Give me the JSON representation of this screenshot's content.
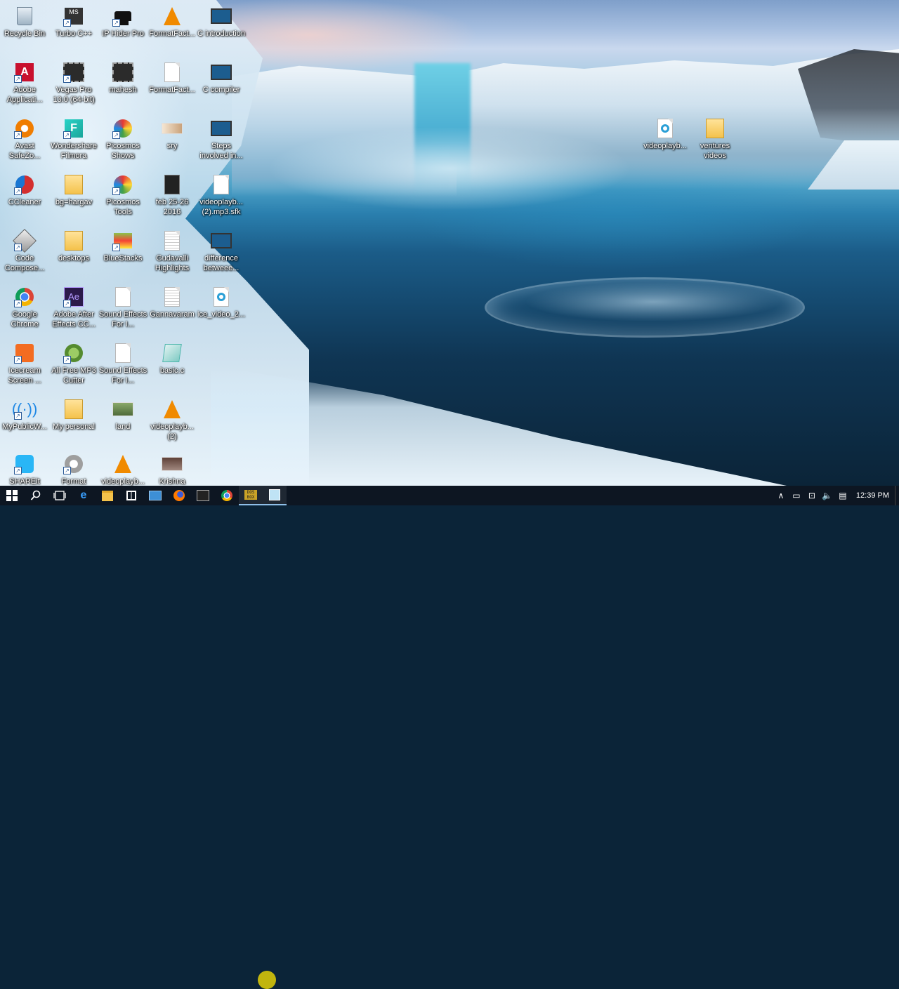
{
  "desktop_icons": [
    {
      "id": "recycle-bin",
      "label": "Recycle Bin",
      "icon": "recycle-bin-icon"
    },
    {
      "id": "turbo-cpp",
      "label": "Turbo C++",
      "icon": "turbo-cpp-icon"
    },
    {
      "id": "ip-hider-pro",
      "label": "IP Hider Pro",
      "icon": "ip-hider-icon"
    },
    {
      "id": "formatfactory-1",
      "label": "FormatFact...",
      "icon": "vlc-cone-icon"
    },
    {
      "id": "c-introduction",
      "label": "C introduction",
      "icon": "video-file-icon"
    },
    {
      "id": "adobe-applications",
      "label": "Adobe Applicati...",
      "icon": "adobe-icon"
    },
    {
      "id": "vegas-pro",
      "label": "Vegas Pro 13.0 (64-bit)",
      "icon": "film-icon"
    },
    {
      "id": "mahesh",
      "label": "mahesh",
      "icon": "film-icon"
    },
    {
      "id": "formatfactory-2",
      "label": "FormatFact...",
      "icon": "document-icon"
    },
    {
      "id": "c-compiler",
      "label": "C compiler",
      "icon": "video-file-icon"
    },
    {
      "id": "avast",
      "label": "Avast SafeZo...",
      "icon": "avast-icon"
    },
    {
      "id": "filmora",
      "label": "Wondershare Filmora",
      "icon": "filmora-icon"
    },
    {
      "id": "picosmos-shows",
      "label": "Picosmos Shows",
      "icon": "picosmos-icon"
    },
    {
      "id": "sry",
      "label": "sry",
      "icon": "image-file-icon"
    },
    {
      "id": "steps-involved",
      "label": "Steps involved in...",
      "icon": "video-file-icon"
    },
    {
      "id": "ccleaner",
      "label": "CCleaner",
      "icon": "ccleaner-icon"
    },
    {
      "id": "bg-hargav",
      "label": "bg=hargav",
      "icon": "zip-folder-icon"
    },
    {
      "id": "picosmos-tools",
      "label": "Picosmos Tools",
      "icon": "picosmos-icon"
    },
    {
      "id": "feb-25-26",
      "label": "feb 25-26 2016",
      "icon": "film-icon"
    },
    {
      "id": "videoplayback-sfk",
      "label": "videoplayb... (2).mp3.sfk",
      "icon": "document-icon"
    },
    {
      "id": "code-composer",
      "label": "Code Compose...",
      "icon": "cube-icon"
    },
    {
      "id": "desktops",
      "label": "desktops",
      "icon": "folder-icon"
    },
    {
      "id": "bluestacks",
      "label": "BlueStacks",
      "icon": "bluestacks-icon"
    },
    {
      "id": "gudavalli",
      "label": "Gudavalli Highlights",
      "icon": "text-file-icon"
    },
    {
      "id": "difference",
      "label": "difference betweee...",
      "icon": "video-file-icon"
    },
    {
      "id": "google-chrome",
      "label": "Google Chrome",
      "icon": "chrome-icon"
    },
    {
      "id": "after-effects",
      "label": "Adobe After Effects CC...",
      "icon": "after-effects-icon"
    },
    {
      "id": "sound-effects-1",
      "label": "Sound Effects For I...",
      "icon": "document-icon"
    },
    {
      "id": "gannavaram",
      "label": "Gannavaram",
      "icon": "text-file-icon"
    },
    {
      "id": "ice-video",
      "label": "ice_video_2...",
      "icon": "media-file-icon"
    },
    {
      "id": "icecream",
      "label": "Icecream Screen ...",
      "icon": "icecream-icon"
    },
    {
      "id": "mp3-cutter",
      "label": "All Free MP3 Cutter",
      "icon": "mp3-cutter-icon"
    },
    {
      "id": "sound-effects-2",
      "label": "Sound Effects For I...",
      "icon": "document-icon"
    },
    {
      "id": "basic-c",
      "label": "basic.c",
      "icon": "c-file-icon"
    },
    {
      "id": "mypublicwifi",
      "label": "MyPublicW...",
      "icon": "wifi-icon"
    },
    {
      "id": "my-personal",
      "label": "My personal",
      "icon": "folder-icon"
    },
    {
      "id": "land",
      "label": "land",
      "icon": "image-file-icon"
    },
    {
      "id": "videoplayback-2",
      "label": "videoplayb... (2)",
      "icon": "vlc-cone-icon"
    },
    {
      "id": "shareit",
      "label": "SHAREit",
      "icon": "shareit-icon"
    },
    {
      "id": "format-factory",
      "label": "Format",
      "icon": "format-factory-icon"
    },
    {
      "id": "videoplayback-3",
      "label": "videoplayb...",
      "icon": "vlc-cone-icon"
    },
    {
      "id": "krishna",
      "label": "Krishna",
      "icon": "image-file-icon"
    },
    {
      "id": "videoplayback-right",
      "label": "videoplayb...",
      "icon": "media-file-icon"
    },
    {
      "id": "ventures-videos",
      "label": "ventures videos",
      "icon": "zip-folder-icon"
    }
  ],
  "taskbar": {
    "start": "start-icon",
    "items": [
      {
        "id": "search",
        "icon": "search-icon"
      },
      {
        "id": "task-view",
        "icon": "task-view-icon"
      },
      {
        "id": "edge",
        "icon": "edge-icon"
      },
      {
        "id": "file-explorer",
        "icon": "folder-icon"
      },
      {
        "id": "store",
        "icon": "store-icon"
      },
      {
        "id": "computer",
        "icon": "monitor-icon"
      },
      {
        "id": "firefox",
        "icon": "firefox-icon"
      },
      {
        "id": "media",
        "icon": "film-icon"
      },
      {
        "id": "chrome",
        "icon": "chrome-icon"
      },
      {
        "id": "dosbox",
        "icon": "dosbox-icon"
      },
      {
        "id": "notepad",
        "icon": "notepad-icon"
      }
    ],
    "clock": "12:39 PM"
  }
}
